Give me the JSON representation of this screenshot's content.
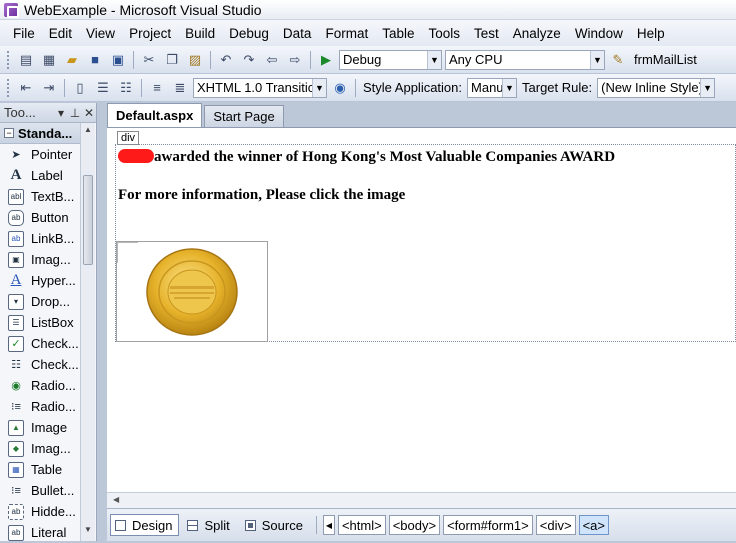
{
  "window": {
    "title": "WebExample - Microsoft Visual Studio"
  },
  "menu": [
    "File",
    "Edit",
    "View",
    "Project",
    "Build",
    "Debug",
    "Data",
    "Format",
    "Table",
    "Tools",
    "Test",
    "Analyze",
    "Window",
    "Help"
  ],
  "toolbar1": {
    "config": "Debug",
    "platform": "Any CPU",
    "find_target": "frmMailList"
  },
  "toolbar2": {
    "doctype": "XHTML 1.0 Transitic",
    "style_application_label": "Style Application:",
    "style_application_value": "Manu",
    "target_rule_label": "Target Rule:",
    "target_rule_value": "(New Inline Style)"
  },
  "toolbox": {
    "title": "Too...",
    "category": "Standa...",
    "items": [
      {
        "label": "Pointer",
        "icon": "pointer-icon"
      },
      {
        "label": "Label",
        "icon": "label-icon"
      },
      {
        "label": "TextB...",
        "icon": "textbox-icon"
      },
      {
        "label": "Button",
        "icon": "button-icon"
      },
      {
        "label": "LinkB...",
        "icon": "linkbutton-icon"
      },
      {
        "label": "Imag...",
        "icon": "imagebutton-icon"
      },
      {
        "label": "Hyper...",
        "icon": "hyperlink-icon"
      },
      {
        "label": "Drop...",
        "icon": "dropdownlist-icon"
      },
      {
        "label": "ListBox",
        "icon": "listbox-icon"
      },
      {
        "label": "Check...",
        "icon": "checkbox-icon"
      },
      {
        "label": "Check...",
        "icon": "checkboxlist-icon"
      },
      {
        "label": "Radio...",
        "icon": "radiobutton-icon"
      },
      {
        "label": "Radio...",
        "icon": "radiobuttonlist-icon"
      },
      {
        "label": "Image",
        "icon": "image-icon"
      },
      {
        "label": "Imag...",
        "icon": "imagemap-icon"
      },
      {
        "label": "Table",
        "icon": "table-icon"
      },
      {
        "label": "Bullet...",
        "icon": "bulletedlist-icon"
      },
      {
        "label": "Hidde...",
        "icon": "hiddenfield-icon"
      },
      {
        "label": "Literal",
        "icon": "literal-icon"
      }
    ]
  },
  "tabs": [
    {
      "label": "Default.aspx",
      "active": true
    },
    {
      "label": "Start Page",
      "active": false
    }
  ],
  "design": {
    "div_tag": "div",
    "line1": "awarded the winner of Hong Kong's Most Valuable Companies AWARD",
    "line2": "For more information, Please click the image"
  },
  "view_buttons": [
    "Design",
    "Split",
    "Source"
  ],
  "breadcrumbs": [
    "<html>",
    "<body>",
    "<form#form1>",
    "<div>",
    "<a>"
  ],
  "colors": {
    "redaction": "#ff1a1a",
    "medal_gold": "#e6b22a"
  }
}
